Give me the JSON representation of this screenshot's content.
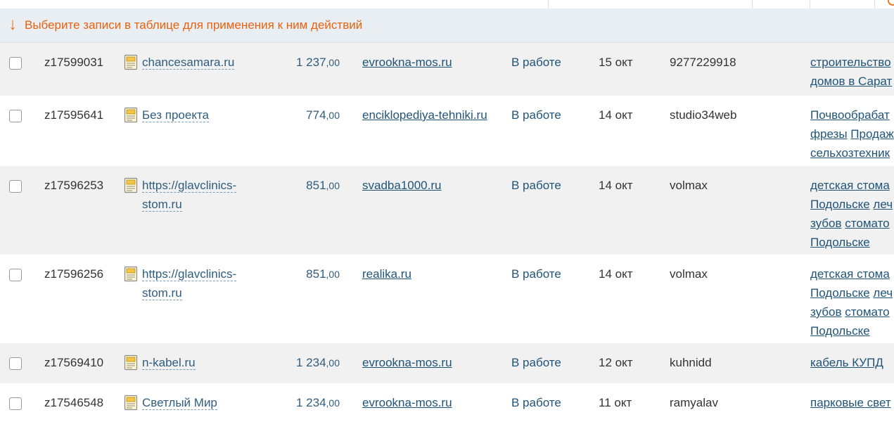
{
  "hint": {
    "arrow": "↓",
    "text": "Выберите записи в таблице для применения к ним действий"
  },
  "rows": [
    {
      "id": "z17599031",
      "project": "chancesamara.ru",
      "price_int": "1 237",
      "price_frac": ",00",
      "site": "evrookna-mos.ru",
      "status": "В работе",
      "date": "15 окт",
      "user": "9277229918",
      "keywords": [
        "строительство",
        "домов в Сарат"
      ]
    },
    {
      "id": "z17595641",
      "project": "Без проекта",
      "price_int": "774",
      "price_frac": ",00",
      "site": "enciklopediya-tehniki.ru",
      "status": "В работе",
      "date": "14 окт",
      "user": "studio34web",
      "keywords": [
        "Почвообрабат",
        "фрезы",
        "Продаж",
        "сельхозтехник"
      ]
    },
    {
      "id": "z17596253",
      "project": "https://glavclinics-stom.ru",
      "price_int": "851",
      "price_frac": ",00",
      "site": "svadba1000.ru",
      "status": "В работе",
      "date": "14 окт",
      "user": "volmax",
      "keywords": [
        "детская стома",
        "Подольске",
        "леч",
        "зубов",
        "стомато",
        "Подольске"
      ]
    },
    {
      "id": "z17596256",
      "project": "https://glavclinics-stom.ru",
      "price_int": "851",
      "price_frac": ",00",
      "site": "realika.ru",
      "status": "В работе",
      "date": "14 окт",
      "user": "volmax",
      "keywords": [
        "детская стома",
        "Подольске",
        "леч",
        "зубов",
        "стомато",
        "Подольске"
      ]
    },
    {
      "id": "z17569410",
      "project": "n-kabel.ru",
      "price_int": "1 234",
      "price_frac": ",00",
      "site": "evrookna-mos.ru",
      "status": "В работе",
      "date": "12 окт",
      "user": "kuhnidd",
      "keywords": [
        "кабель КУПД"
      ]
    },
    {
      "id": "z17546548",
      "project": "Светлый Мир",
      "price_int": "1 234",
      "price_frac": ",00",
      "site": "evrookna-mos.ru",
      "status": "В работе",
      "date": "11 окт",
      "user": "ramyalav",
      "keywords": [
        "парковые свет"
      ]
    }
  ],
  "colors": {
    "accent_orange": "#e8620e",
    "link_blue": "#1f5478",
    "row_shade": "#f1f1f1",
    "hint_bg": "#e9eef3"
  },
  "icons": {
    "project_icon": "document-icon",
    "row_select": "checkbox"
  }
}
